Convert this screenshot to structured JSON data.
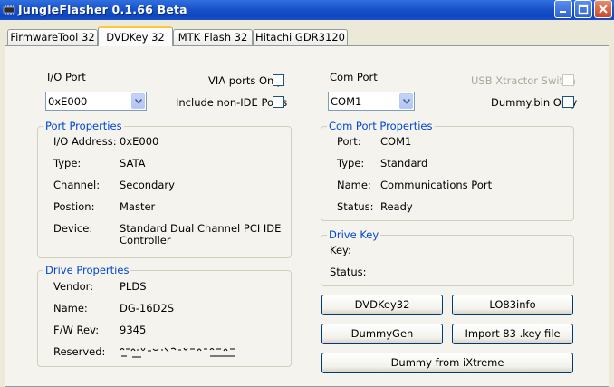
{
  "window": {
    "title": "JungleFlasher 0.1.66 Beta"
  },
  "tabs": [
    {
      "label": "FirmwareTool 32",
      "active": false
    },
    {
      "label": "DVDKey 32",
      "active": true
    },
    {
      "label": "MTK Flash 32",
      "active": false
    },
    {
      "label": "Hitachi GDR3120",
      "active": false
    }
  ],
  "io_port": {
    "label": "I/O Port",
    "value": "0xE000",
    "via_ports_only": {
      "label": "VIA ports Only",
      "checked": false
    },
    "include_non_ide": {
      "label": "Include non-IDE Ports",
      "checked": false
    }
  },
  "port_properties": {
    "title": "Port Properties",
    "rows": [
      {
        "label": "I/O Address:",
        "value": "0xE000"
      },
      {
        "label": "Type:",
        "value": "SATA"
      },
      {
        "label": "Channel:",
        "value": "Secondary"
      },
      {
        "label": "Postion:",
        "value": "Master"
      },
      {
        "label": "Device:",
        "value": "Standard Dual Channel PCI IDE",
        "value2": "Controller"
      }
    ]
  },
  "drive_properties": {
    "title": "Drive Properties",
    "rows": [
      {
        "label": "Vendor:",
        "value": "PLDS"
      },
      {
        "label": "Name:",
        "value": "DG-16D2S"
      },
      {
        "label": "F/W Rev:",
        "value": "9345"
      },
      {
        "label": "Reserved:",
        "value": ""
      }
    ]
  },
  "com_port": {
    "label": "Com Port",
    "value": "COM1",
    "usb_xtractor": {
      "label": "USB Xtractor Switch",
      "checked": false,
      "enabled": false
    },
    "dummy_bin_only": {
      "label": "Dummy.bin Only",
      "checked": false
    }
  },
  "com_port_properties": {
    "title": "Com Port Properties",
    "rows": [
      {
        "label": "Port:",
        "value": "COM1"
      },
      {
        "label": "Type:",
        "value": "Standard"
      },
      {
        "label": "Name:",
        "value": "Communications Port"
      },
      {
        "label": "Status:",
        "value": "Ready"
      }
    ]
  },
  "drive_key": {
    "title": "Drive Key",
    "key_label": "Key:",
    "status_label": "Status:"
  },
  "buttons": {
    "dvdkey32": "DVDKey32",
    "lo83info": "LO83info",
    "dummygen": "DummyGen",
    "import_key": "Import 83 .key file",
    "dummy_ixtreme": "Dummy from iXtreme"
  },
  "colors": {
    "title_bar": "#0D45C2",
    "group_title": "#0046D5",
    "panel_bg": "#F4F3EE",
    "window_bg": "#ECE9D8",
    "active_tab_accent": "#FFC83C"
  }
}
